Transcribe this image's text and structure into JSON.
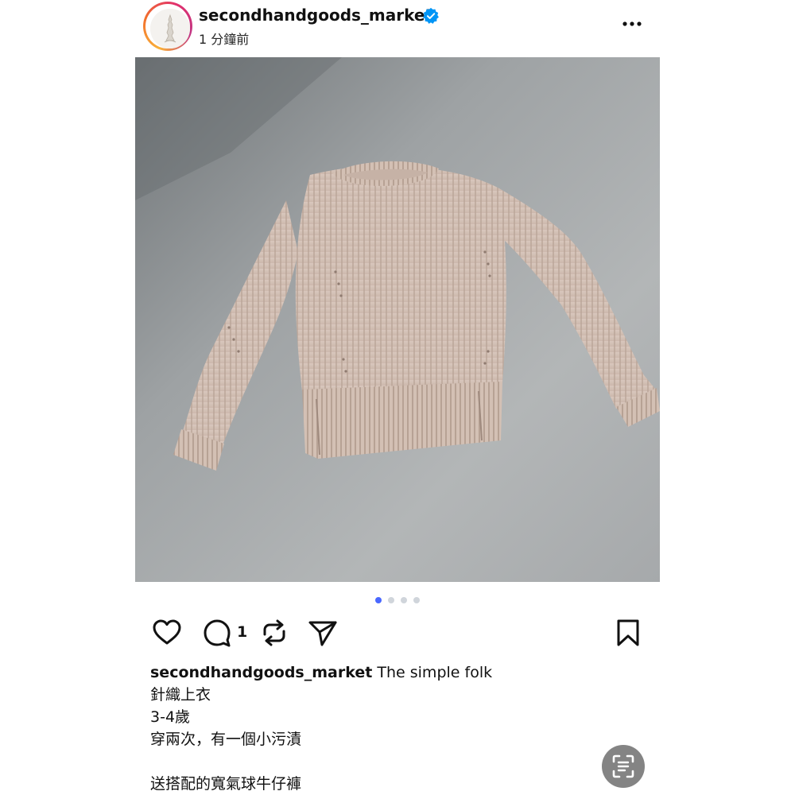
{
  "post": {
    "username": "secondhandgoods_market",
    "timestamp": "1 分鐘前",
    "comment_count": "1",
    "carousel": {
      "total": 4,
      "current": 1
    },
    "caption": {
      "username": "secondhandgoods_market",
      "first_line": "The simple folk",
      "lines": [
        "針織上衣",
        "3-4歲",
        "穿兩次，有一個小污漬",
        "",
        "送搭配的寬氣球牛仔褲"
      ]
    }
  },
  "icons": {
    "verified": "verified-badge-icon",
    "more": "more-options-icon",
    "like": "heart-icon",
    "comment": "comment-icon",
    "repost": "repost-icon",
    "share": "send-icon",
    "save": "bookmark-icon",
    "scan": "text-scan-icon"
  },
  "colors": {
    "verified_blue": "#0095f6",
    "active_dot": "#4a68ff",
    "inactive_dot": "#d0d5db"
  }
}
